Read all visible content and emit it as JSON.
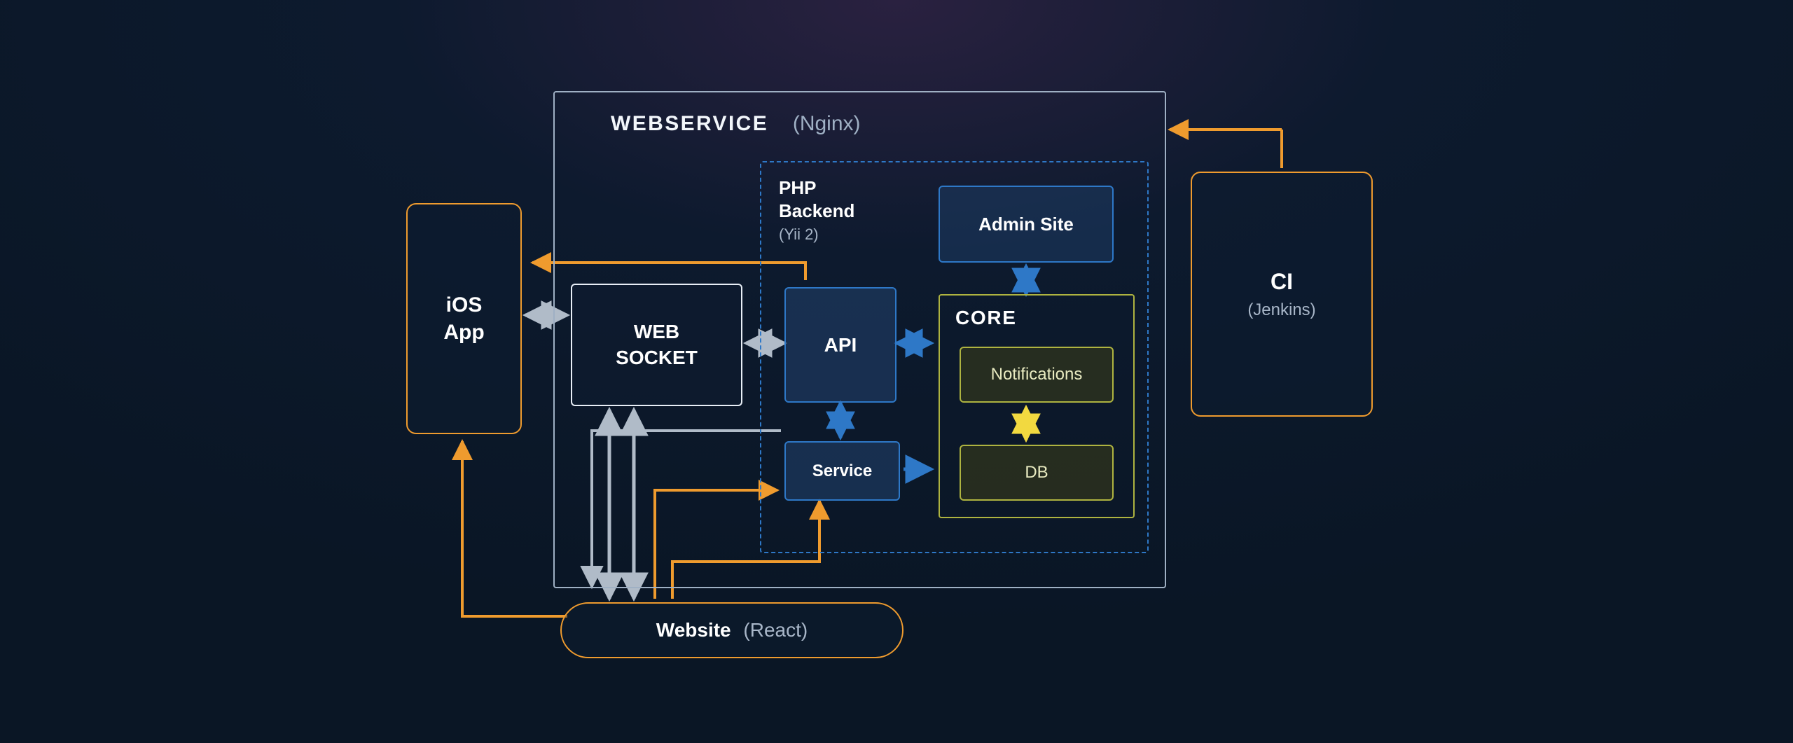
{
  "colors": {
    "orange": "#ef9b2e",
    "blue": "#2e78c7",
    "gray": "#b0bbc8",
    "white": "#e8eef6",
    "olive": "#aeb340",
    "yellow": "#f2d940",
    "panelFill": "rgba(30,60,100,0.55)",
    "panelFillDark": "rgba(14,28,48,0.6)",
    "oliveFill": "rgba(70,70,20,0.45)"
  },
  "webservice": {
    "title": "WEBSERVICE",
    "tech": "(Nginx)"
  },
  "ios": {
    "title1": "iOS",
    "title2": "App"
  },
  "websocket": {
    "title1": "WEB",
    "title2": "SOCKET"
  },
  "php": {
    "title1": "PHP",
    "title2": "Backend",
    "tech": "(Yii 2)"
  },
  "api": {
    "label": "API"
  },
  "service": {
    "label": "Service"
  },
  "admin": {
    "label": "Admin Site"
  },
  "core": {
    "label": "CORE"
  },
  "notifications": {
    "label": "Notifications"
  },
  "db": {
    "label": "DB"
  },
  "ci": {
    "title": "CI",
    "tech": "(Jenkins)"
  },
  "website": {
    "title": "Website",
    "tech": "(React)"
  }
}
